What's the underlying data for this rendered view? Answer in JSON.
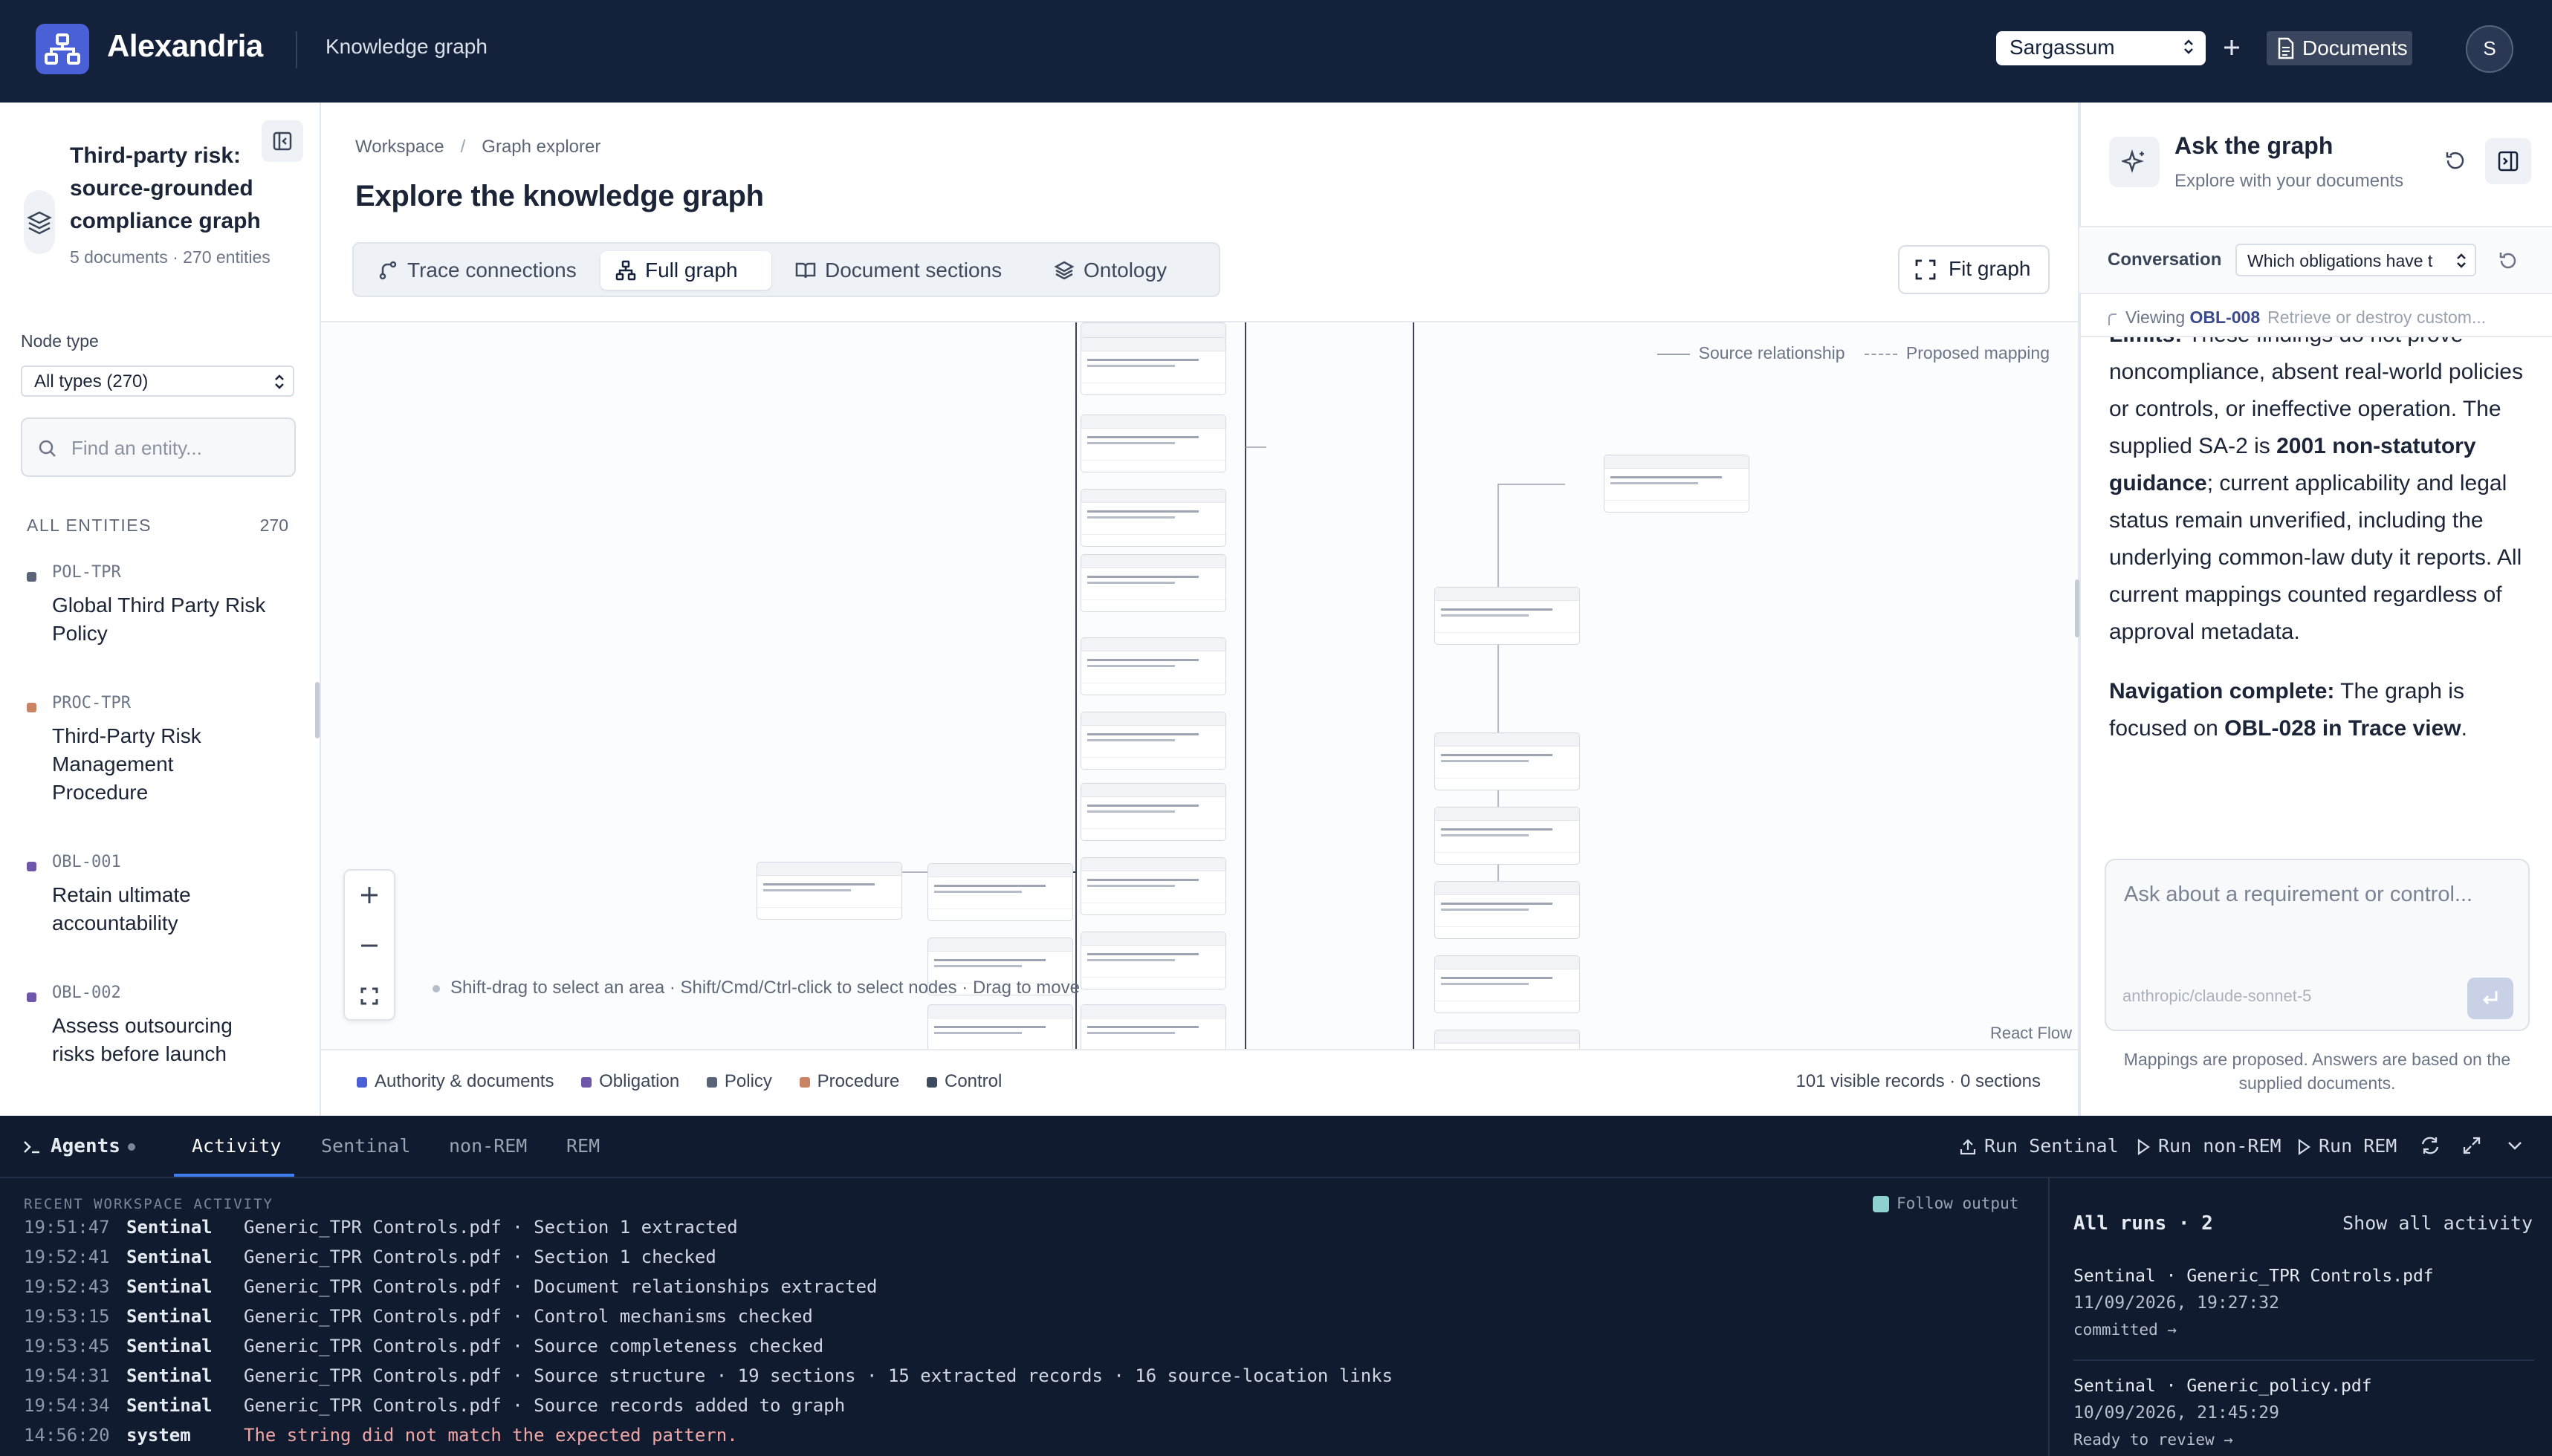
{
  "app": {
    "name": "Alexandria",
    "section": "Knowledge graph",
    "workspace_selected": "Sargassum",
    "documents_label": "Documents",
    "avatar_initial": "S",
    "colors": {
      "topbar": "#14213a",
      "accent": "#4a60d6",
      "terminal": "#101b30"
    }
  },
  "project": {
    "title": "Third-party risk: source-grounded compliance graph",
    "meta": "5 documents · 270 entities"
  },
  "filters": {
    "node_type_label": "Node type",
    "node_type_selected": "All types (270)",
    "search_placeholder": "Find an entity..."
  },
  "entities": {
    "header": "ALL ENTITIES",
    "count": "270",
    "items": [
      {
        "code": "POL-TPR",
        "name": "Global Third Party Risk Policy",
        "color": "#5a6478"
      },
      {
        "code": "PROC-TPR",
        "name": "Third-Party Risk Management Procedure",
        "color": "#c98464"
      },
      {
        "code": "OBL-001",
        "name": "Retain ultimate accountability",
        "color": "#6e56a8"
      },
      {
        "code": "OBL-002",
        "name": "Assess outsourcing risks before launch",
        "color": "#6e56a8"
      }
    ]
  },
  "main": {
    "breadcrumb": [
      "Workspace",
      "Graph explorer"
    ],
    "title": "Explore the knowledge graph",
    "tabs": [
      {
        "label": "Trace connections",
        "icon": "route-icon"
      },
      {
        "label": "Full graph",
        "icon": "graph-icon"
      },
      {
        "label": "Document sections",
        "icon": "book-icon"
      },
      {
        "label": "Ontology",
        "icon": "layers-icon"
      }
    ],
    "active_tab": "Full graph",
    "fit_label": "Fit graph",
    "legend_top": [
      "Source relationship",
      "Proposed mapping"
    ],
    "hint": "Shift-drag to select an area · Shift/Cmd/Ctrl-click to select nodes · Drag to move",
    "attribution": "React Flow",
    "legend_bottom": [
      {
        "label": "Authority & documents",
        "color": "#4a60d6"
      },
      {
        "label": "Obligation",
        "color": "#6e56a8"
      },
      {
        "label": "Policy",
        "color": "#5a6478"
      },
      {
        "label": "Procedure",
        "color": "#c98464"
      },
      {
        "label": "Control",
        "color": "#3e4a5e"
      }
    ],
    "record_count": "101 visible records · 0 sections"
  },
  "chat": {
    "title": "Ask the graph",
    "subtitle": "Explore with your documents",
    "conversation_label": "Conversation",
    "conversation_selected": "Which obligations have t",
    "viewing_prefix": "Viewing",
    "viewing_id": "OBL-008",
    "viewing_desc": "Retrieve or destroy custom...",
    "answer": {
      "p1_bold_a": "Limits:",
      "p1_a": " These findings do not prove noncompliance, absent real-world policies or controls, or ineffective operation. The supplied SA-2 is ",
      "p1_bold_b": "2001 non-statutory guidance",
      "p1_b": "; current applicability and legal status remain unverified, including the underlying common-law duty it reports. All current mappings counted regardless of approval metadata.",
      "p2_bold_a": "Navigation complete:",
      "p2_a": " The graph is focused on ",
      "p2_bold_b": "OBL-028 in Trace view",
      "p2_b": "."
    },
    "input_placeholder": "Ask about a requirement or control...",
    "model": "anthropic/claude-sonnet-5",
    "disclaimer": "Mappings are proposed. Answers are based on the supplied documents."
  },
  "agents": {
    "title": "Agents",
    "tabs": [
      "Activity",
      "Sentinal",
      "non-REM",
      "REM"
    ],
    "active_tab": "Activity",
    "actions": [
      "Run Sentinal",
      "Run non-REM",
      "Run REM"
    ],
    "recent_header": "RECENT WORKSPACE ACTIVITY",
    "follow_label": "Follow output",
    "log": [
      {
        "time": "19:51:47",
        "source": "Sentinal",
        "message": "Generic_TPR Controls.pdf · Section 1 extracted",
        "error": false
      },
      {
        "time": "19:52:41",
        "source": "Sentinal",
        "message": "Generic_TPR Controls.pdf · Section 1 checked",
        "error": false
      },
      {
        "time": "19:52:43",
        "source": "Sentinal",
        "message": "Generic_TPR Controls.pdf · Document relationships extracted",
        "error": false
      },
      {
        "time": "19:53:15",
        "source": "Sentinal",
        "message": "Generic_TPR Controls.pdf · Control mechanisms checked",
        "error": false
      },
      {
        "time": "19:53:45",
        "source": "Sentinal",
        "message": "Generic_TPR Controls.pdf · Source completeness checked",
        "error": false
      },
      {
        "time": "19:54:31",
        "source": "Sentinal",
        "message": "Generic_TPR Controls.pdf · Source structure · 19 sections · 15 extracted records · 16 source-location links",
        "error": false
      },
      {
        "time": "19:54:34",
        "source": "Sentinal",
        "message": "Generic_TPR Controls.pdf · Source records added to graph",
        "error": false
      },
      {
        "time": "14:56:20",
        "source": "system",
        "message": "The string did not match the expected pattern.",
        "error": true
      }
    ],
    "runs_header": "All runs · 2",
    "show_all": "Show all activity",
    "runs": [
      {
        "title": "Sentinal · Generic_TPR Controls.pdf",
        "date": "11/09/2026, 19:27:32",
        "status": "committed →"
      },
      {
        "title": "Sentinal · Generic_policy.pdf",
        "date": "10/09/2026, 21:45:29",
        "status": "Ready to review →"
      }
    ]
  }
}
